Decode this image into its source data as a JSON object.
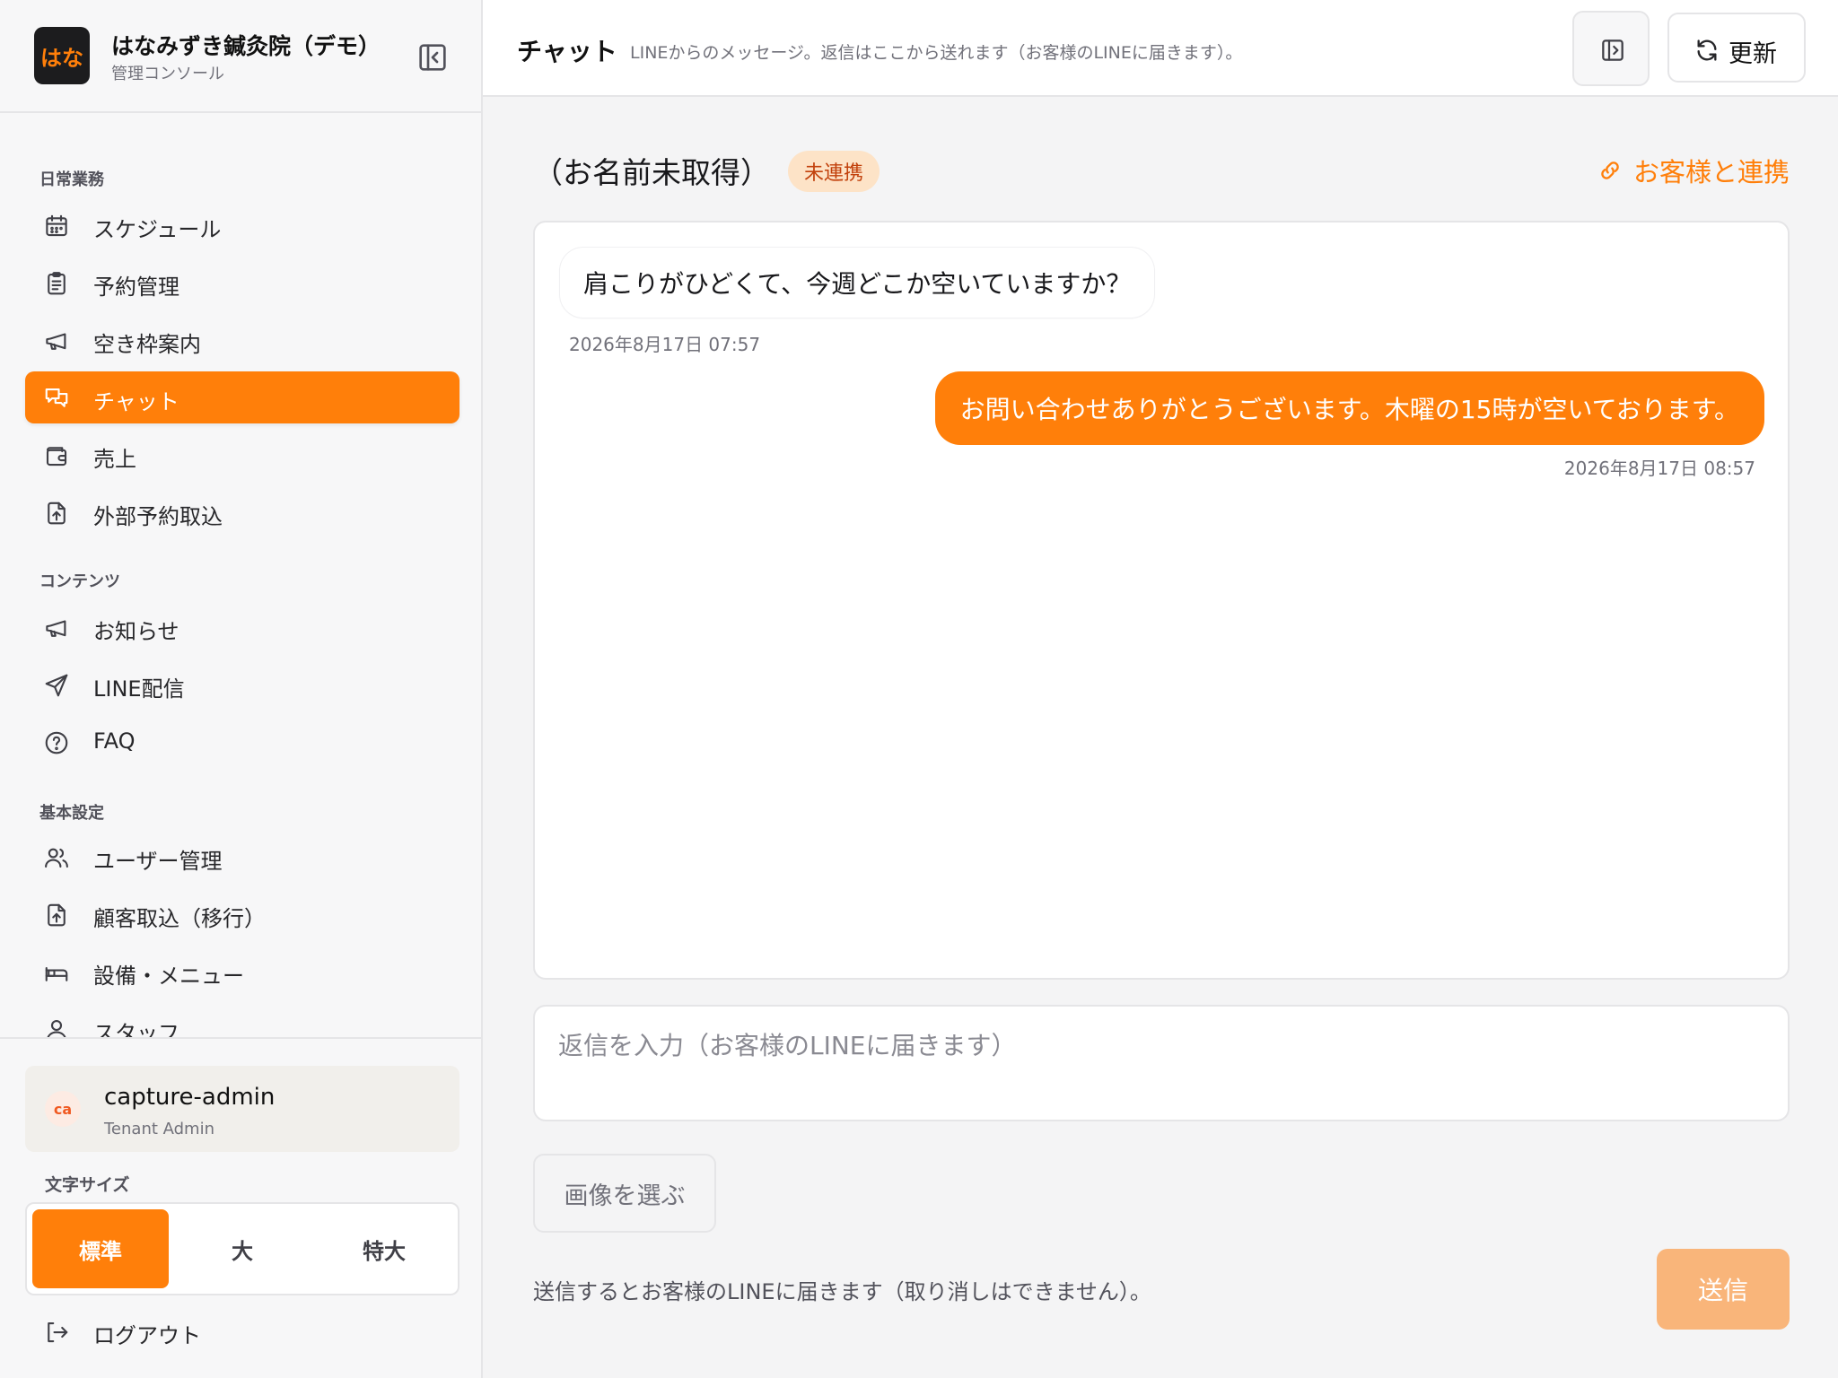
{
  "brand": {
    "logo_text": "はな",
    "name": "はなみずき鍼灸院（デモ）",
    "subtitle": "管理コンソール"
  },
  "sidebar": {
    "sections": [
      {
        "title": "日常業務",
        "items": [
          {
            "label": "スケジュール",
            "icon": "calendar-icon"
          },
          {
            "label": "予約管理",
            "icon": "clipboard-icon"
          },
          {
            "label": "空き枠案内",
            "icon": "megaphone-icon"
          },
          {
            "label": "チャット",
            "icon": "chat-icon",
            "active": true
          },
          {
            "label": "売上",
            "icon": "wallet-icon"
          },
          {
            "label": "外部予約取込",
            "icon": "file-upload-icon"
          }
        ]
      },
      {
        "title": "コンテンツ",
        "items": [
          {
            "label": "お知らせ",
            "icon": "megaphone-icon"
          },
          {
            "label": "LINE配信",
            "icon": "send-icon"
          },
          {
            "label": "FAQ",
            "icon": "question-icon"
          }
        ]
      },
      {
        "title": "基本設定",
        "items": [
          {
            "label": "ユーザー管理",
            "icon": "users-icon"
          },
          {
            "label": "顧客取込（移行）",
            "icon": "file-upload-icon"
          },
          {
            "label": "設備・メニュー",
            "icon": "bed-icon"
          },
          {
            "label": "スタッフ",
            "icon": "user-icon"
          }
        ]
      }
    ],
    "user": {
      "initials": "ca",
      "name": "capture-admin",
      "role": "Tenant Admin"
    },
    "font_size": {
      "label": "文字サイズ",
      "options": [
        "標準",
        "大",
        "特大"
      ],
      "selected": "標準"
    },
    "logout_label": "ログアウト"
  },
  "header": {
    "title": "チャット",
    "description": "LINEからのメッセージ。返信はここから送れます（お客様のLINEに届きます）。",
    "refresh_label": "更新"
  },
  "chat": {
    "customer_name": "（お名前未取得）",
    "status_badge": "未連携",
    "link_label": "お客様と連携",
    "messages": [
      {
        "direction": "in",
        "text": "肩こりがひどくて、今週どこか空いていますか？",
        "time": "2026年8月17日 07:57"
      },
      {
        "direction": "out",
        "text": "お問い合わせありがとうございます。木曜の15時が空いております。",
        "time": "2026年8月17日 08:57"
      }
    ],
    "input_placeholder": "返信を入力（お客様のLINEに届きます）",
    "pick_image_label": "画像を選ぶ",
    "send_note": "送信するとお客様のLINEに届きます（取り消しはできません）。",
    "send_label": "送信"
  },
  "colors": {
    "accent": "#ff7f0a",
    "badge_bg": "#fde3c7",
    "badge_text": "#c2410c",
    "send_disabled": "#f9b57a"
  }
}
